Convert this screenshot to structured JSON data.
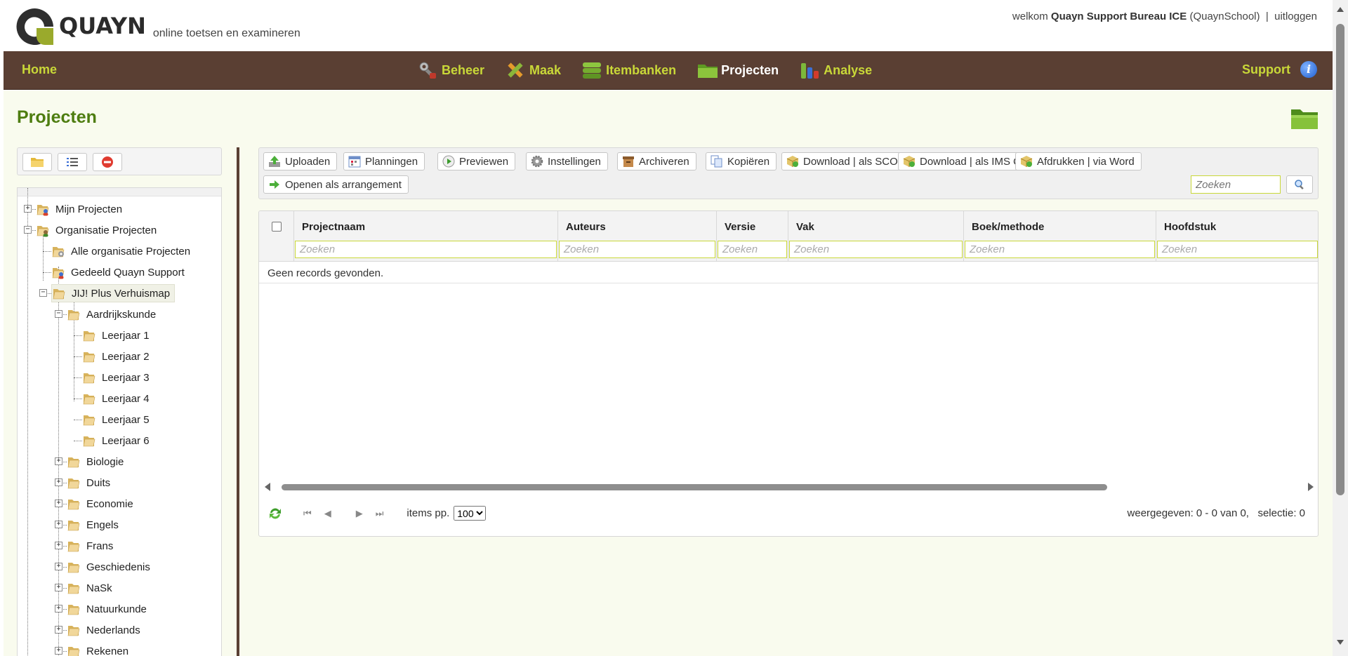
{
  "header": {
    "logo_text": "QUAYN",
    "tagline": "online toetsen en examineren",
    "welcome_prefix": "welkom",
    "user_name": "Quayn Support Bureau ICE",
    "school": "(QuaynSchool)",
    "separator": "|",
    "logout": "uitloggen"
  },
  "nav": {
    "home": "Home",
    "items": [
      {
        "label": "Beheer",
        "icon": "wrench-icon"
      },
      {
        "label": "Maak",
        "icon": "pencil-ruler-icon"
      },
      {
        "label": "Itembanken",
        "icon": "database-stack-icon"
      },
      {
        "label": "Projecten",
        "icon": "folder-icon",
        "active": true
      },
      {
        "label": "Analyse",
        "icon": "bar-chart-icon"
      }
    ],
    "support": "Support"
  },
  "page": {
    "title": "Projecten"
  },
  "left_toolbar": {
    "buttons": [
      "new-folder-icon",
      "list-icon",
      "delete-icon"
    ]
  },
  "tree": {
    "nodes": [
      {
        "label": "Mijn Projecten"
      },
      {
        "label": "Organisatie Projecten"
      },
      {
        "label": "Alle organisatie Projecten"
      },
      {
        "label": "Gedeeld Quayn Support"
      },
      {
        "label": "JIJ! Plus Verhuismap"
      },
      {
        "label": "Aardrijkskunde"
      },
      {
        "label": "Leerjaar 1"
      },
      {
        "label": "Leerjaar 2"
      },
      {
        "label": "Leerjaar 3"
      },
      {
        "label": "Leerjaar 4"
      },
      {
        "label": "Leerjaar 5"
      },
      {
        "label": "Leerjaar 6"
      },
      {
        "label": "Biologie"
      },
      {
        "label": "Duits"
      },
      {
        "label": "Economie"
      },
      {
        "label": "Engels"
      },
      {
        "label": "Frans"
      },
      {
        "label": "Geschiedenis"
      },
      {
        "label": "NaSk"
      },
      {
        "label": "Natuurkunde"
      },
      {
        "label": "Nederlands"
      },
      {
        "label": "Rekenen"
      }
    ]
  },
  "toolbar": {
    "buttons": [
      {
        "label": "Uploaden",
        "icon": "upload-icon"
      },
      {
        "label": "Planningen",
        "icon": "calendar-icon"
      },
      {
        "label": "Previewen",
        "icon": "play-icon"
      },
      {
        "label": "Instellingen",
        "icon": "gear-icon"
      },
      {
        "label": "Archiveren",
        "icon": "archive-icon"
      },
      {
        "label": "Kopiëren",
        "icon": "copy-icon"
      },
      {
        "label": "Download | als SCORM",
        "icon": "package-icon"
      },
      {
        "label": "Download | als IMS QTI",
        "icon": "package-icon"
      },
      {
        "label": "Afdrukken | via Word",
        "icon": "package-icon"
      },
      {
        "label": "Openen als arrangement",
        "icon": "arrow-right-icon"
      }
    ],
    "search_placeholder": "Zoeken"
  },
  "grid": {
    "columns": [
      {
        "title": "Projectnaam",
        "filter_placeholder": "Zoeken"
      },
      {
        "title": "Auteurs",
        "filter_placeholder": "Zoeken"
      },
      {
        "title": "Versie",
        "filter_placeholder": "Zoeken"
      },
      {
        "title": "Vak",
        "filter_placeholder": "Zoeken"
      },
      {
        "title": "Boek/methode",
        "filter_placeholder": "Zoeken"
      },
      {
        "title": "Hoofdstuk",
        "filter_placeholder": "Zoeken"
      }
    ],
    "empty_message": "Geen records gevonden.",
    "items_per_page_label": "items pp.",
    "items_per_page": "100",
    "items_per_page_options": [
      "100"
    ],
    "info": "weergegeven: 0 - 0 van 0,   selectie: 0"
  },
  "colors": {
    "nav_bg": "#5a3f33",
    "nav_text": "#c9d838",
    "title_green": "#4e7d10",
    "content_bg": "#f9fbee"
  }
}
